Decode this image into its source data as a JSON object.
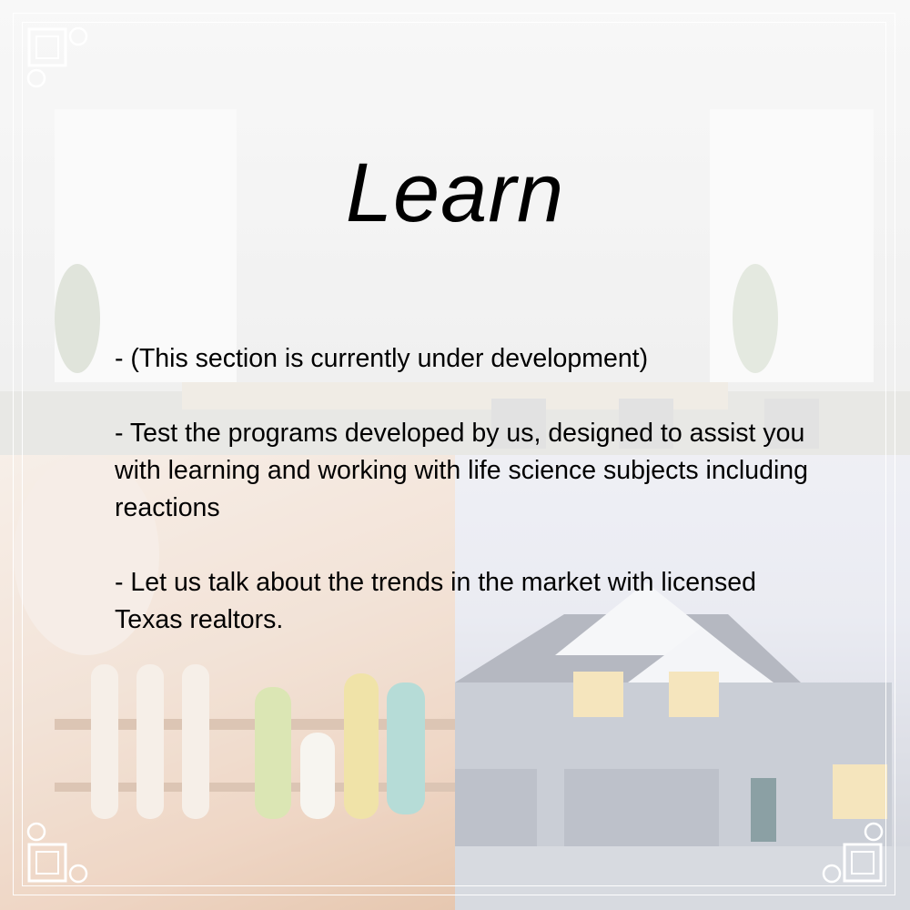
{
  "title": "Learn",
  "paragraphs": [
    "- (This section is currently under development)",
    "- Test the programs developed by us, designed to assist you with learning and working with life science subjects including reactions",
    "- Let us talk about the trends in the market with licensed Texas realtors."
  ],
  "colors": {
    "text": "#000000",
    "frame": "#ffffff",
    "lab_tint": "#e6c1a7",
    "house_tint": "#cfd2dd"
  }
}
